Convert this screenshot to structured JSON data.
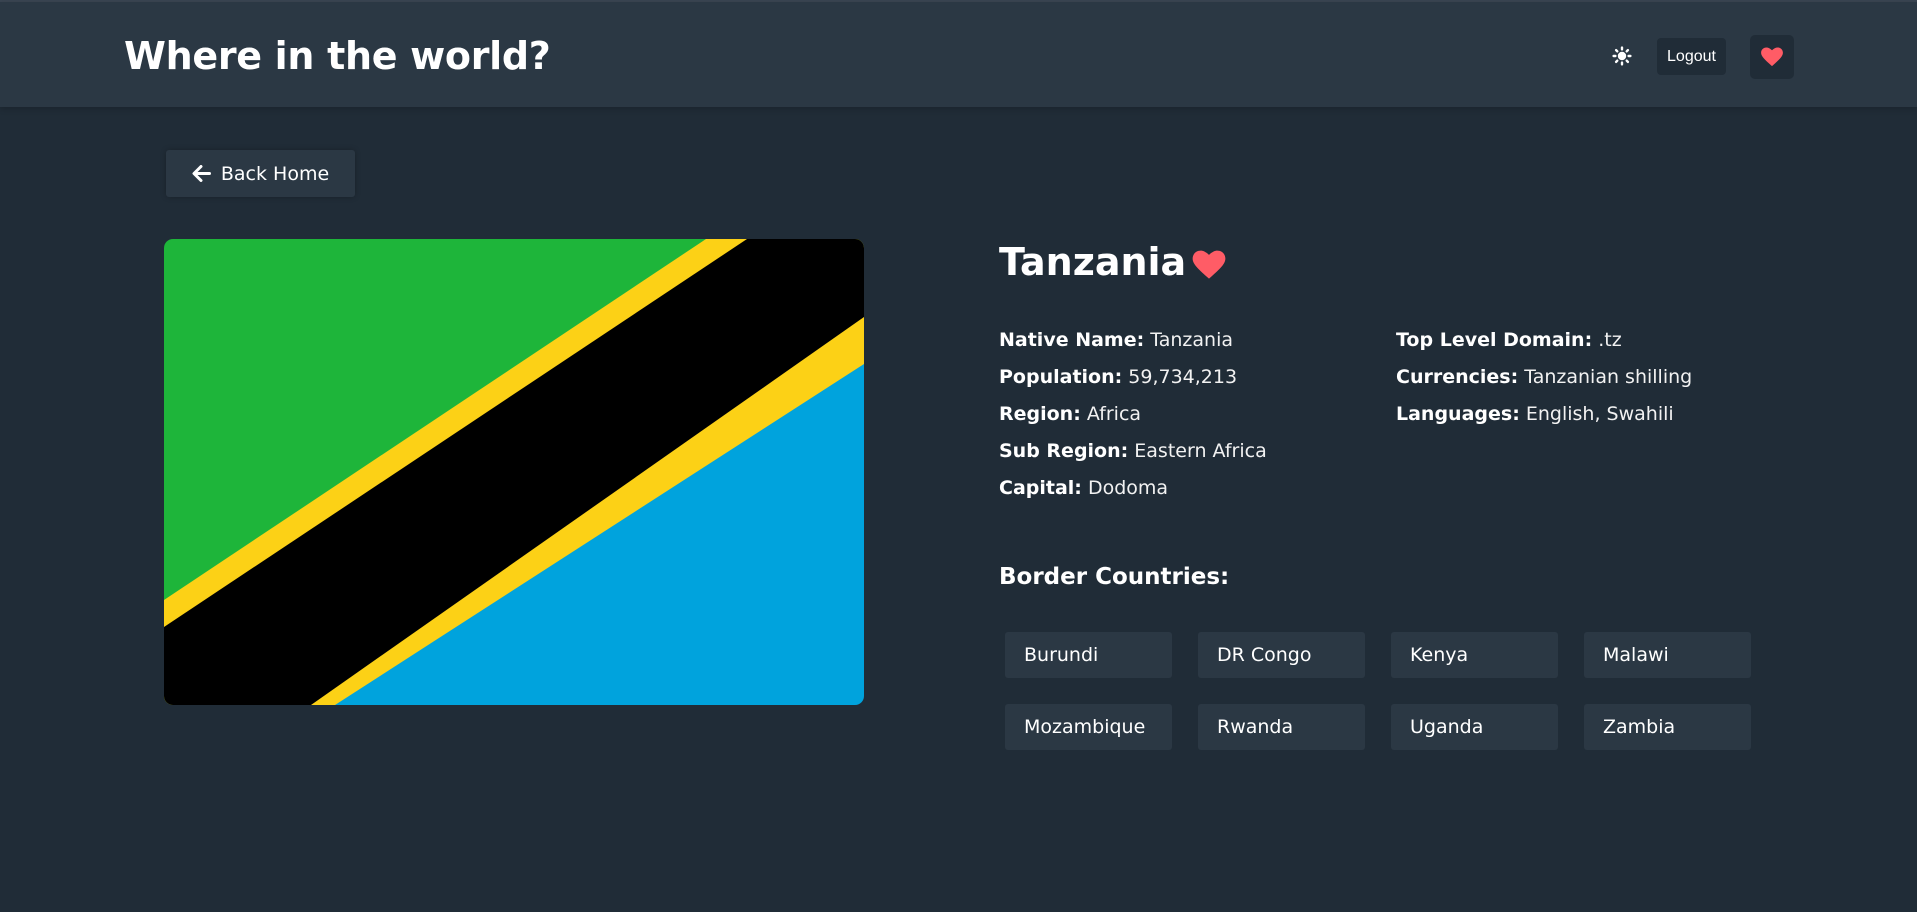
{
  "header": {
    "title": "Where in the world?",
    "theme_icon": "sun-icon",
    "logout_label": "Logout",
    "favorites_icon": "heart-icon"
  },
  "back_button": {
    "label": "Back Home",
    "icon": "arrow-left-icon"
  },
  "country": {
    "name": "Tanzania",
    "favorite_icon": "heart-icon",
    "flag_colors": {
      "green": "#1eb53a",
      "yellow": "#fcd116",
      "black": "#000000",
      "blue": "#00a3dd"
    },
    "details_left": [
      {
        "label": "Native Name:",
        "value": "Tanzania"
      },
      {
        "label": "Population:",
        "value": "59,734,213"
      },
      {
        "label": "Region:",
        "value": "Africa"
      },
      {
        "label": "Sub Region:",
        "value": "Eastern Africa"
      },
      {
        "label": "Capital:",
        "value": "Dodoma"
      }
    ],
    "details_right": [
      {
        "label": "Top Level Domain:",
        "value": ".tz"
      },
      {
        "label": "Currencies:",
        "value": "Tanzanian shilling"
      },
      {
        "label": "Languages:",
        "value": "English, Swahili"
      }
    ],
    "border_title": "Border Countries:",
    "borders": [
      "Burundi",
      "DR Congo",
      "Kenya",
      "Malawi",
      "Mozambique",
      "Rwanda",
      "Uganda",
      "Zambia"
    ]
  },
  "colors": {
    "background": "#202c37",
    "element": "#2b3844",
    "heart": "#ff5c66",
    "text": "#ffffff"
  }
}
